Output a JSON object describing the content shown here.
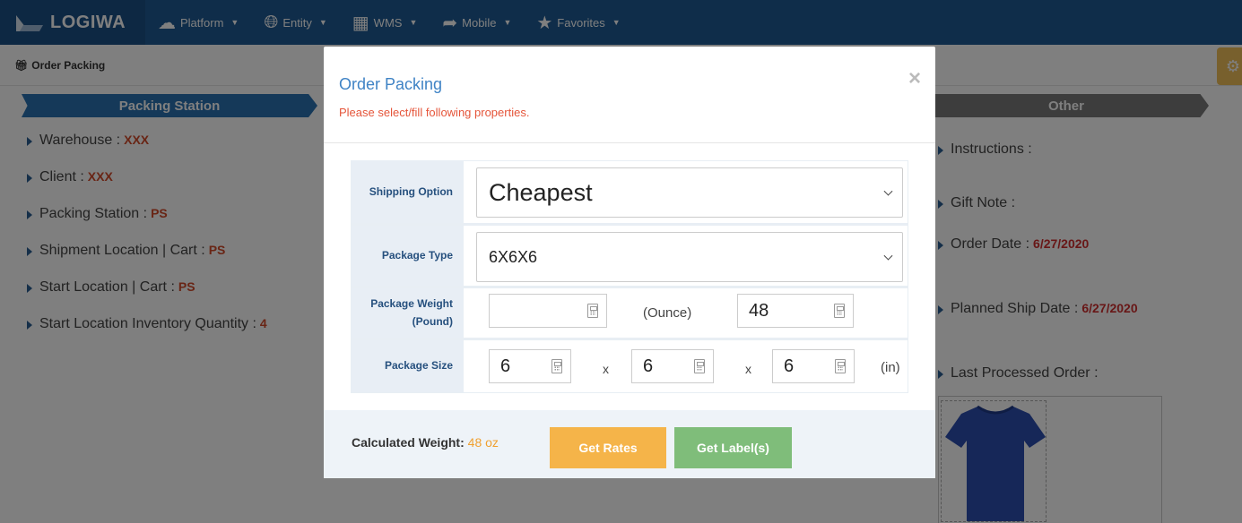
{
  "nav": {
    "brand": "LOGIWA",
    "items": [
      {
        "label": "Platform",
        "icon": "cloud-icon"
      },
      {
        "label": "Entity",
        "icon": "globe-icon"
      },
      {
        "label": "WMS",
        "icon": "building-icon"
      },
      {
        "label": "Mobile",
        "icon": "share-arrow-icon"
      },
      {
        "label": "Favorites",
        "icon": "star-icon"
      }
    ]
  },
  "breadcrumb": "Order Packing",
  "left_panel": {
    "title": "Packing Station",
    "rows": [
      {
        "label": "Warehouse :",
        "value": "XXX"
      },
      {
        "label": "Client :",
        "value": "XXX"
      },
      {
        "label": "Packing Station :",
        "value": "PS"
      },
      {
        "label": "Shipment Location | Cart :",
        "value": "PS"
      },
      {
        "label": "Start Location | Cart :",
        "value": "PS"
      },
      {
        "label": "Start Location Inventory Quantity :",
        "value": "4"
      }
    ]
  },
  "right_panel": {
    "title": "Other",
    "instructions_label": "Instructions :",
    "gift_note_label": "Gift Note :",
    "order_date_label": "Order Date :",
    "order_date": "6/27/2020",
    "planned_ship_label": "Planned Ship Date :",
    "planned_ship_date": "6/27/2020",
    "last_processed_label": "Last Processed Order :"
  },
  "modal": {
    "title": "Order Packing",
    "subtitle": "Please select/fill following properties.",
    "close": "×",
    "shipping_option_label": "Shipping Option",
    "shipping_option_value": "Cheapest",
    "package_type_label": "Package Type",
    "package_type_value": "6X6X6",
    "package_weight_label_1": "Package Weight",
    "package_weight_label_2": "(Pound)",
    "pound_value": "",
    "ounce_label": "(Ounce)",
    "ounce_value": "48",
    "package_size_label": "Package Size",
    "size_l": "6",
    "size_w": "6",
    "size_h": "6",
    "size_x": "x",
    "size_unit": "(in)",
    "calculated_weight_label": "Calculated Weight:",
    "calculated_weight_value": "48 oz",
    "get_rates": "Get Rates",
    "get_labels": "Get Label(s)"
  }
}
